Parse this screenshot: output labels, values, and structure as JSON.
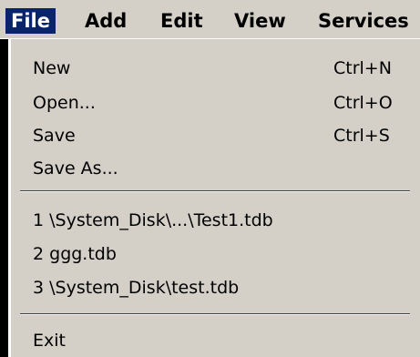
{
  "menubar": {
    "items": [
      "File",
      "Add",
      "Edit",
      "View",
      "Services"
    ],
    "active": "File"
  },
  "file_menu": {
    "items": [
      {
        "label": "New",
        "shortcut": "Ctrl+N"
      },
      {
        "label": "Open...",
        "shortcut": "Ctrl+O"
      },
      {
        "label": "Save",
        "shortcut": "Ctrl+S"
      },
      {
        "label": "Save As...",
        "shortcut": ""
      }
    ],
    "recent": [
      "1 \\System_Disk\\...\\Test1.tdb",
      "2 ggg.tdb",
      "3 \\System_Disk\\test.tdb"
    ],
    "exit": "Exit"
  },
  "colors": {
    "menu_bg": "#d4d0c8",
    "highlight_bg": "#0a246a",
    "highlight_text": "#ffffff"
  }
}
